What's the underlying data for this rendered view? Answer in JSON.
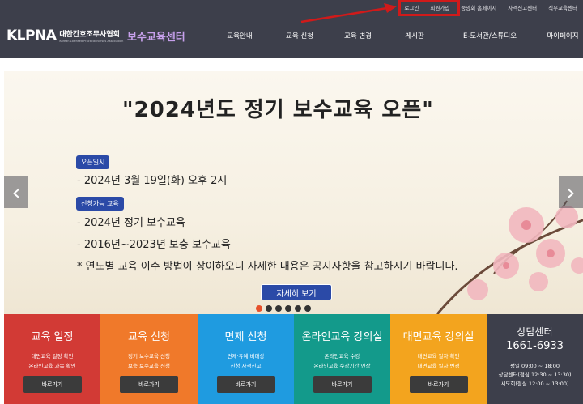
{
  "header": {
    "util_links": [
      "로그인",
      "회원가입",
      "중앙회 홈페이지",
      "자격신고센터",
      "직무교육센터"
    ],
    "logo_mark": "KLPNA",
    "logo_kor": "대한간호조무사협회",
    "logo_eng": "Korean Licensed Practical Nurses Association",
    "site_title": "보수교육센터",
    "nav": [
      "교육안내",
      "교육 신청",
      "교육 변경",
      "게시판",
      "E-도서관/스튜디오",
      "마이페이지"
    ]
  },
  "hero": {
    "title": "\"2024년도 정기 보수교육 오픈\"",
    "badge_open": "오픈일시",
    "open_date": "- 2024년 3월 19일(화) 오후 2시",
    "badge_courses": "신청가능 교육",
    "course_1": "- 2024년 정기 보수교육",
    "course_2": "- 2016년~2023년 보충 보수교육",
    "notice": "* 연도별 교육 이수 방법이 상이하오니 자세한 내용은 공지사항을 참고하시기 바랍니다.",
    "detail_button": "자세히 보기",
    "prev_arrow": "‹",
    "next_arrow": "›"
  },
  "tiles": [
    {
      "title": "교육 일정",
      "line1": "대면교육 일정 확인",
      "line2": "온라인교육 과목 확인",
      "button": "바로가기",
      "color": "#d23a35"
    },
    {
      "title": "교육 신청",
      "line1": "정기 보수교육 신청",
      "line2": "보충 보수교육 신청",
      "button": "바로가기",
      "color": "#f0792a"
    },
    {
      "title": "면제 신청",
      "line1": "면제·유예·비대상",
      "line2": "신청 자격신고",
      "button": "바로가기",
      "color": "#1f9be0"
    },
    {
      "title": "온라인교육 강의실",
      "line1": "온라인교육 수강",
      "line2": "온라인교육 수강기간 연장",
      "button": "바로가기",
      "color": "#139a8b"
    },
    {
      "title": "대면교육 강의실",
      "line1": "대면교육 일자 확인",
      "line2": "대면교육 일자 변경",
      "button": "바로가기",
      "color": "#f3a41e"
    }
  ],
  "consult": {
    "title": "상담센터",
    "phone": "1661-6933",
    "hours": "평일 09:00 ~ 18:00",
    "lunch1": "상담센터(점심 12:30 ~ 13:30)",
    "lunch2": "시도회(점심 12:00 ~ 13:00)",
    "color": "#3d3f4b"
  }
}
